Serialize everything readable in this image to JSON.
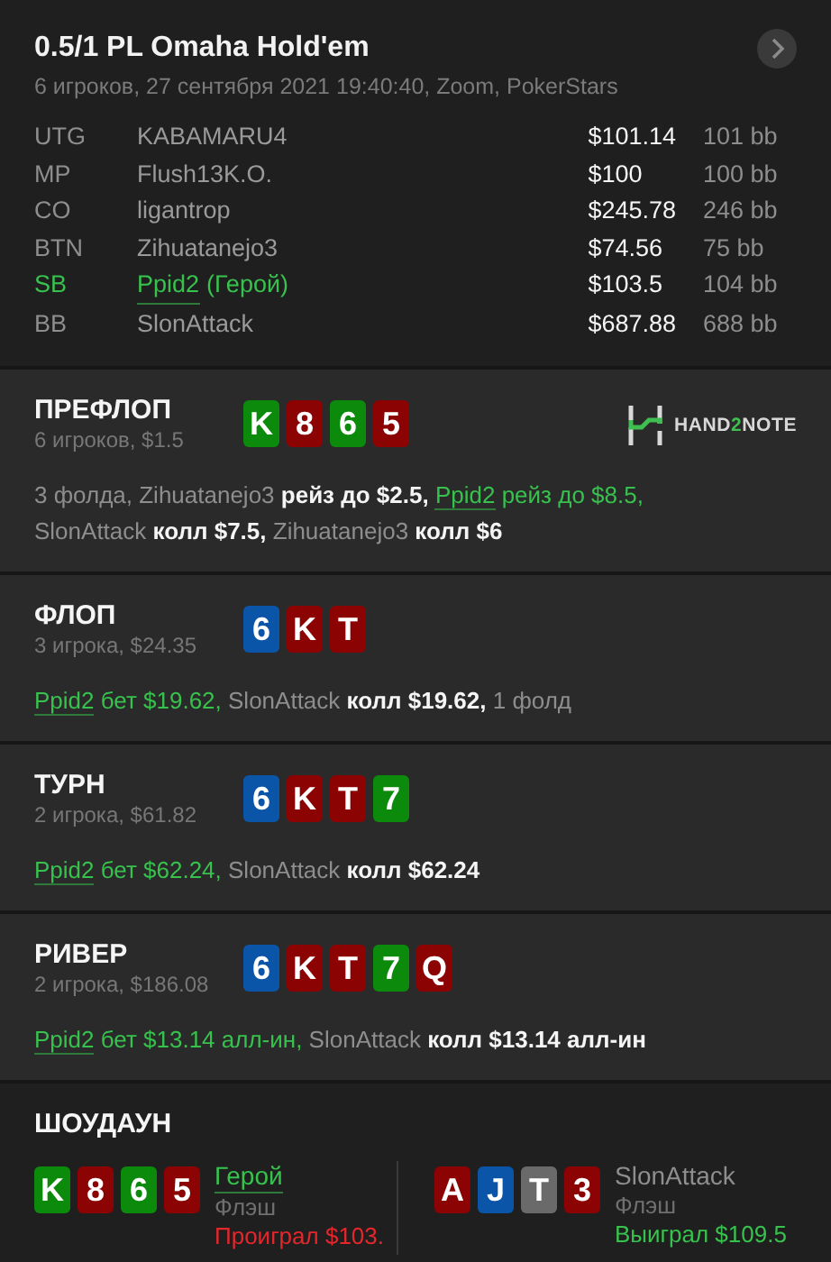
{
  "header": {
    "title": "0.5/1 PL Omaha Hold'em",
    "subtitle": "6 игроков, 27 сентября 2021 19:40:40, Zoom, PokerStars",
    "next_icon": true
  },
  "players": [
    {
      "position": "UTG",
      "name": "KABAMARU4",
      "hero": false,
      "stack": "$101.14",
      "bb": "101 bb"
    },
    {
      "position": "MP",
      "name": "Flush13K.O.",
      "hero": false,
      "stack": "$100",
      "bb": "100 bb"
    },
    {
      "position": "CO",
      "name": "ligantrop",
      "hero": false,
      "stack": "$245.78",
      "bb": "246 bb"
    },
    {
      "position": "BTN",
      "name": "Zihuatanejo3",
      "hero": false,
      "stack": "$74.56",
      "bb": "75 bb"
    },
    {
      "position": "SB",
      "name": "Ppid2",
      "suffix": "(Герой)",
      "hero": true,
      "stack": "$103.5",
      "bb": "104 bb"
    },
    {
      "position": "BB",
      "name": "SlonAttack",
      "hero": false,
      "stack": "$687.88",
      "bb": "688 bb"
    }
  ],
  "streets": [
    {
      "title": "ПРЕФЛОП",
      "info": "6 игроков, $1.5",
      "cards": [
        {
          "rank": "K",
          "color": "#0b8a0b"
        },
        {
          "rank": "8",
          "color": "#8c0303"
        },
        {
          "rank": "6",
          "color": "#0b8a0b"
        },
        {
          "rank": "5",
          "color": "#8c0303"
        }
      ],
      "logo": {
        "parts": [
          {
            "text": "HAND",
            "accent": false
          },
          {
            "text": "2",
            "accent": true
          },
          {
            "text": "NOTE",
            "accent": false
          }
        ]
      },
      "actions": [
        {
          "kind": "plain",
          "text": "3 фолда, "
        },
        {
          "kind": "name",
          "text": "Zihuatanejo3"
        },
        {
          "kind": "action",
          "text": " рейз до $2.5, "
        },
        {
          "kind": "hero",
          "text": "Ppid2"
        },
        {
          "kind": "hero_action",
          "text": " рейз до $8.5, "
        },
        {
          "kind": "name",
          "text": "SlonAttack"
        },
        {
          "kind": "action",
          "text": " колл $7.5, "
        },
        {
          "kind": "name",
          "text": "Zihuatanejo3"
        },
        {
          "kind": "action",
          "text": " колл $6"
        }
      ]
    },
    {
      "title": "ФЛОП",
      "info": "3 игрока, $24.35",
      "cards": [
        {
          "rank": "6",
          "color": "#0b55a8"
        },
        {
          "rank": "K",
          "color": "#8c0303"
        },
        {
          "rank": "T",
          "color": "#8c0303"
        }
      ],
      "actions": [
        {
          "kind": "hero",
          "text": "Ppid2"
        },
        {
          "kind": "hero_action",
          "text": " бет $19.62, "
        },
        {
          "kind": "name",
          "text": "SlonAttack"
        },
        {
          "kind": "action",
          "text": " колл $19.62, "
        },
        {
          "kind": "plain",
          "text": "1 фолд"
        }
      ]
    },
    {
      "title": "ТУРН",
      "info": "2 игрока, $61.82",
      "cards": [
        {
          "rank": "6",
          "color": "#0b55a8"
        },
        {
          "rank": "K",
          "color": "#8c0303"
        },
        {
          "rank": "T",
          "color": "#8c0303"
        },
        {
          "rank": "7",
          "color": "#0b8a0b"
        }
      ],
      "actions": [
        {
          "kind": "hero",
          "text": "Ppid2"
        },
        {
          "kind": "hero_action",
          "text": " бет $62.24, "
        },
        {
          "kind": "name",
          "text": "SlonAttack"
        },
        {
          "kind": "action",
          "text": " колл $62.24"
        }
      ]
    },
    {
      "title": "РИВЕР",
      "info": "2 игрока, $186.08",
      "cards": [
        {
          "rank": "6",
          "color": "#0b55a8"
        },
        {
          "rank": "K",
          "color": "#8c0303"
        },
        {
          "rank": "T",
          "color": "#8c0303"
        },
        {
          "rank": "7",
          "color": "#0b8a0b"
        },
        {
          "rank": "Q",
          "color": "#8c0303"
        }
      ],
      "actions": [
        {
          "kind": "hero",
          "text": "Ppid2"
        },
        {
          "kind": "hero_action",
          "text": " бет $13.14 алл-ин, "
        },
        {
          "kind": "name",
          "text": "SlonAttack"
        },
        {
          "kind": "action",
          "text": " колл $13.14 алл-ин"
        }
      ]
    }
  ],
  "showdown": {
    "title": "ШОУДАУН",
    "hands": [
      {
        "player": "Герой",
        "hero": true,
        "combination": "Флэш",
        "result": "Проиграл $103.",
        "won": false,
        "cards": [
          {
            "rank": "K",
            "color": "#0b8a0b"
          },
          {
            "rank": "8",
            "color": "#8c0303"
          },
          {
            "rank": "6",
            "color": "#0b8a0b"
          },
          {
            "rank": "5",
            "color": "#8c0303"
          }
        ]
      },
      {
        "player": "SlonAttack",
        "hero": false,
        "combination": "Флэш",
        "result": "Выиграл $109.5",
        "won": true,
        "cards": [
          {
            "rank": "A",
            "color": "#8c0303"
          },
          {
            "rank": "J",
            "color": "#0b55a8"
          },
          {
            "rank": "T",
            "color": "#6a6a6a"
          },
          {
            "rank": "3",
            "color": "#8c0303"
          }
        ]
      }
    ]
  }
}
